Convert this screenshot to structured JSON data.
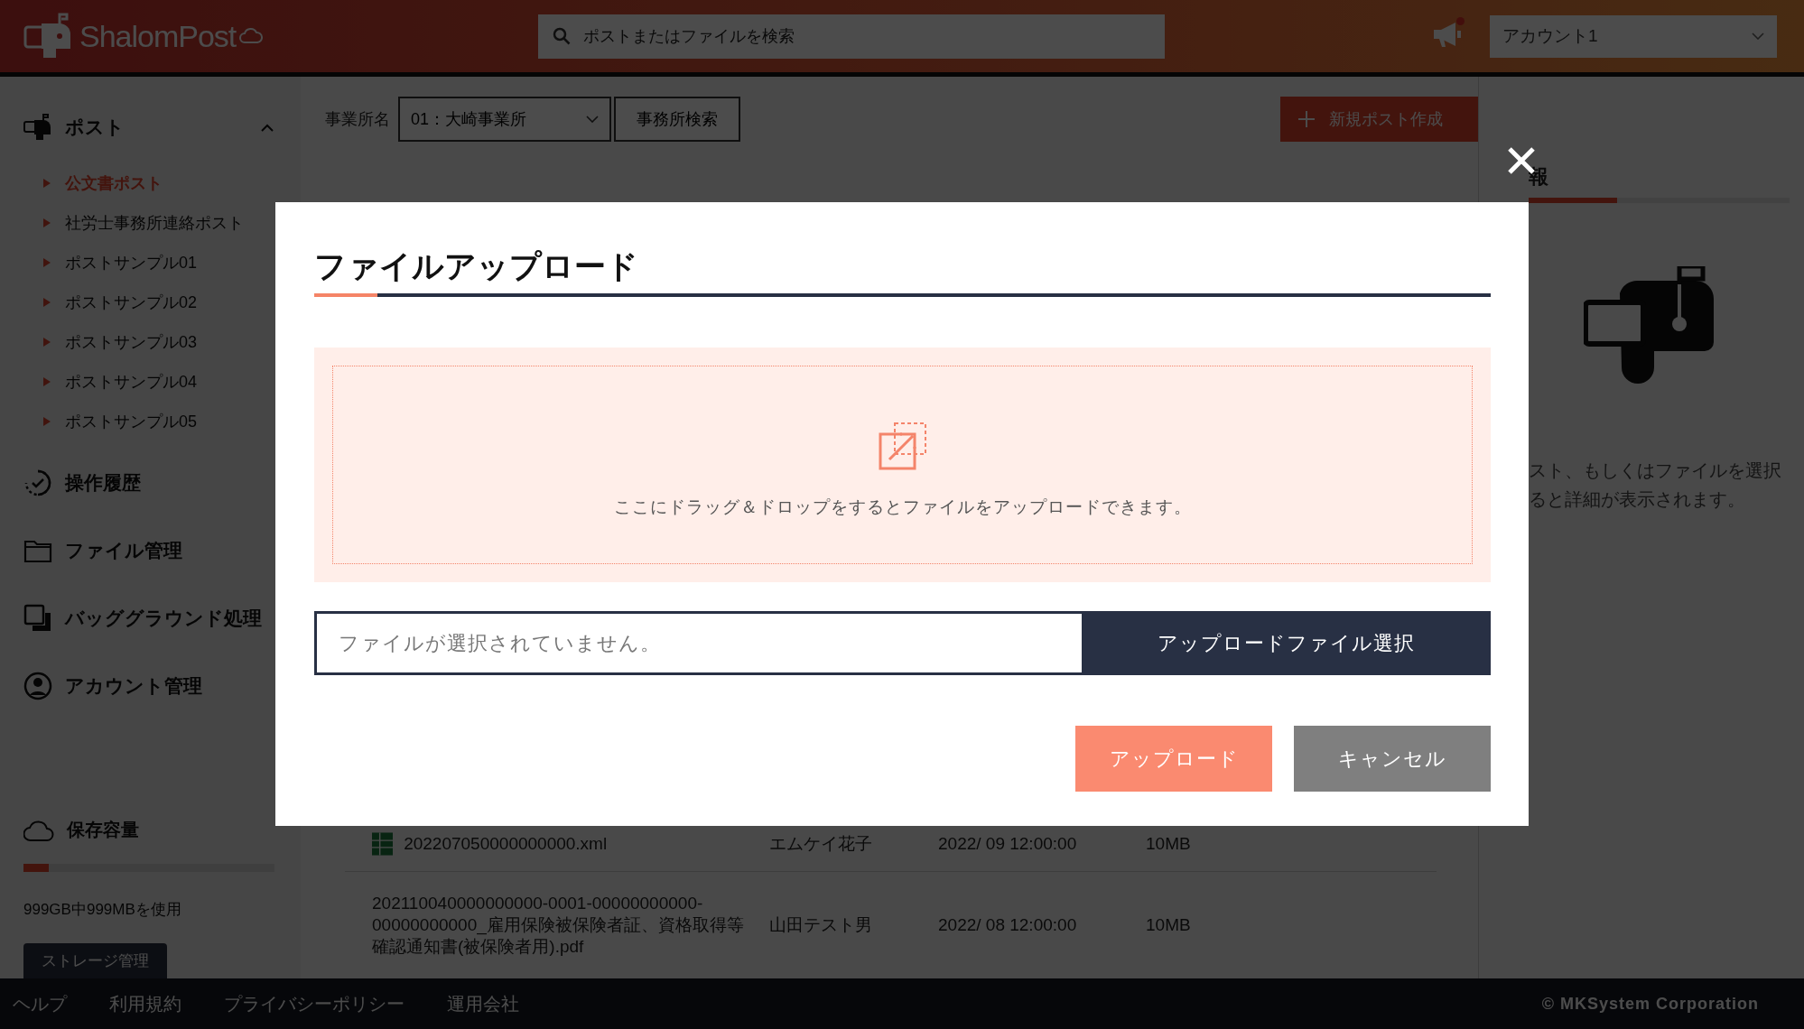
{
  "header": {
    "logo": "ShalomPost",
    "search": {
      "placeholder": "ポストまたはファイルを検索"
    },
    "has_notification": true,
    "account": "アカウント1"
  },
  "sidebar": {
    "post": {
      "label": "ポスト",
      "expanded": true,
      "items": [
        {
          "label": "公文書ポスト",
          "selected": true
        },
        {
          "label": "社労士事務所連絡ポスト",
          "selected": false
        },
        {
          "label": "ポストサンプル01",
          "selected": false
        },
        {
          "label": "ポストサンプル02",
          "selected": false
        },
        {
          "label": "ポストサンプル03",
          "selected": false
        },
        {
          "label": "ポストサンプル04",
          "selected": false
        },
        {
          "label": "ポストサンプル05",
          "selected": false
        }
      ]
    },
    "nav": [
      {
        "label": "操作履歴"
      },
      {
        "label": "ファイル管理"
      },
      {
        "label": "バッググラウンド処理"
      },
      {
        "label": "アカウント管理"
      }
    ],
    "storage": {
      "label": "保存容量",
      "level": 0.1,
      "usage": "999GB中999MBを使用",
      "button": "ストレージ管理"
    }
  },
  "toolbar": {
    "office_label": "事業所名",
    "office_select": "01：大崎事業所",
    "office_search_button": "事務所検索",
    "new_post_button": "新規ポスト作成"
  },
  "files": [
    {
      "kind": "xml",
      "name": "202207050000000000.xml",
      "owner": "エムケイ花子",
      "date": "2022/ 09 12:00:00",
      "size": "10MB"
    },
    {
      "kind": "pdf",
      "name": "202110040000000000-0001-00000000000-00000000000_雇用保険被保険者証、資格取得等確認通知書(被保険者用).pdf",
      "owner": "山田テスト男",
      "date": "2022/ 08 12:00:00",
      "size": "10MB"
    }
  ],
  "detail_panel": {
    "tab": "報",
    "message": [
      "スト、もしくはファイルを選択",
      "ると詳細が表示されます。"
    ]
  },
  "modal": {
    "title": "ファイルアップロード",
    "drop_hint": "ここにドラッグ＆ドロップをするとファイルをアップロードできます。",
    "file_field": {
      "placeholder": "ファイルが選択されていません。"
    },
    "choose_button": "アップロードファイル選択",
    "upload_button": "アップロード",
    "cancel_button": "キャンセル"
  },
  "footer": {
    "links": [
      "ヘルプ",
      "利用規約",
      "プライバシーポリシー",
      "運用会社"
    ],
    "copyright": "© MKSystem Corporation"
  }
}
